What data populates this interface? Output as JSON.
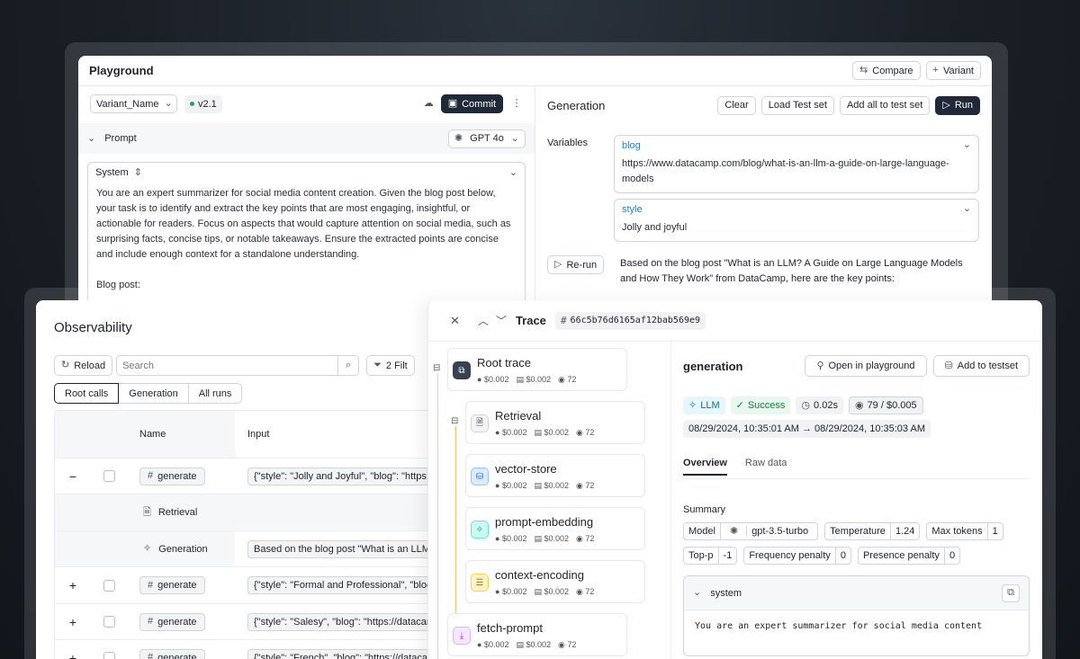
{
  "playground": {
    "title": "Playground",
    "compare_label": "Compare",
    "variant_label": "Variant",
    "variant_name": "Variant_Name",
    "version": "v2.1",
    "commit_label": "Commit",
    "prompt_label": "Prompt",
    "model": "GPT 4o",
    "system_role": "System",
    "system_text": "You are an expert summarizer for social media content creation. Given the blog post below, your task is to identify and extract the key points that are most engaging, insightful, or actionable for readers. Focus on aspects that would capture attention on social media, such as surprising facts, concise tips, or notable takeaways. Ensure the extracted points are concise and include enough context for a standalone understanding.",
    "blog_post_label": "Blog post:",
    "generation_title": "Generation",
    "clear_label": "Clear",
    "load_test_label": "Load Test set",
    "add_all_label": "Add all to test set",
    "run_label": "Run",
    "variables_label": "Variables",
    "variables": [
      {
        "name": "blog",
        "value": "https://www.datacamp.com/blog/what-is-an-llm-a-guide-on-large-language-models"
      },
      {
        "name": "style",
        "value": "Jolly and joyful"
      }
    ],
    "rerun_label": "Re-run",
    "output_text": "Based on the blog post \"What is an LLM? A Guide on Large Language Models and How They Work\" from DataCamp, here are the key points:"
  },
  "observability": {
    "title": "Observability",
    "reload_label": "Reload",
    "search_placeholder": "Search",
    "filter_label": "2 Filt",
    "tabs": [
      "Root calls",
      "Generation",
      "All runs"
    ],
    "columns": {
      "name": "Name",
      "input": "Input"
    },
    "rows": [
      {
        "expander": "−",
        "checkbox": true,
        "name": "generate",
        "tag": true,
        "input": "{\"style\": \"Jolly and Joyful\", \"blog\": \"https:/"
      },
      {
        "expander": "",
        "checkbox": false,
        "name": "Retrieval",
        "icon": "doc",
        "input": ""
      },
      {
        "expander": "",
        "checkbox": false,
        "name": "Generation",
        "icon": "sparkle",
        "input": "Based on the blog post \"What is an LLM"
      },
      {
        "expander": "+",
        "checkbox": true,
        "name": "generate",
        "tag": true,
        "input": "{\"style\": \"Formal and Professional\", \"blog\""
      },
      {
        "expander": "+",
        "checkbox": true,
        "name": "generate",
        "tag": true,
        "input": "{\"style\": \"Salesy\", \"blog\": \"https://datacan"
      },
      {
        "expander": "+",
        "checkbox": true,
        "name": "generate",
        "tag": true,
        "input": "{\"style\": \"French\", \"blog\": \"https://datacan"
      }
    ]
  },
  "trace": {
    "title": "Trace",
    "id": "66c5b76d6165af12bab569e9",
    "spans": [
      {
        "name": "Root trace",
        "cost1": "$0.002",
        "cost2": "$0.002",
        "tokens": "72"
      },
      {
        "name": "Retrieval",
        "cost1": "$0.002",
        "cost2": "$0.002",
        "tokens": "72"
      },
      {
        "name": "vector-store",
        "cost1": "$0.002",
        "cost2": "$0.002",
        "tokens": "72"
      },
      {
        "name": "prompt-embedding",
        "cost1": "$0.002",
        "cost2": "$0.002",
        "tokens": "72"
      },
      {
        "name": "context-encoding",
        "cost1": "$0.002",
        "cost2": "$0.002",
        "tokens": "72"
      },
      {
        "name": "fetch-prompt",
        "cost1": "$0.002",
        "cost2": "$0.002",
        "tokens": "72"
      }
    ],
    "detail": {
      "title": "generation",
      "open_playground_label": "Open in playground",
      "add_testset_label": "Add to testset",
      "badge_llm": "LLM",
      "badge_status": "Success",
      "latency": "0.02s",
      "tokens_cost": "79 / $0.005",
      "time_range": "08/29/2024, 10:35:01 AM → 08/29/2024, 10:35:03 AM",
      "tabs": [
        "Overview",
        "Raw data"
      ],
      "summary_label": "Summary",
      "params": [
        {
          "key": "Model",
          "value": "gpt-3.5-turbo"
        },
        {
          "key": "Temperature",
          "value": "1.24"
        },
        {
          "key": "Max tokens",
          "value": "1"
        },
        {
          "key": "Top-p",
          "value": "-1"
        },
        {
          "key": "Frequency penalty",
          "value": "0"
        },
        {
          "key": "Presence penalty",
          "value": "0"
        }
      ],
      "message_role": "system",
      "message_text": "You are an expert summarizer for social media content"
    }
  }
}
